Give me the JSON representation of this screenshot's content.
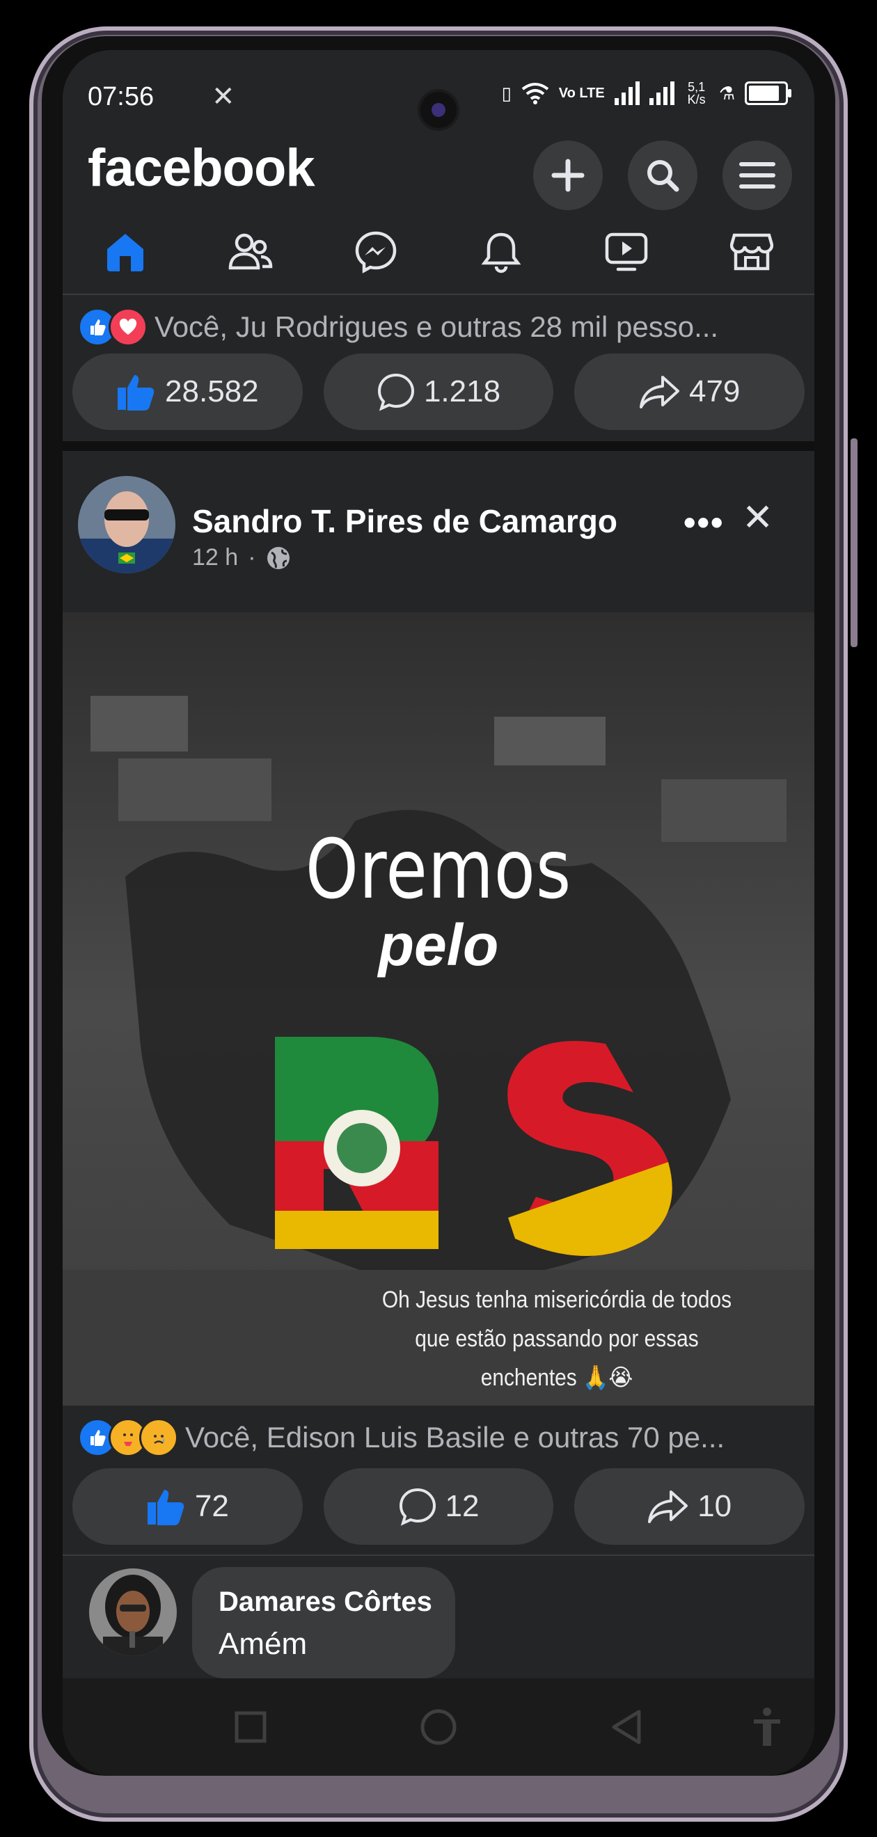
{
  "status_bar": {
    "time": "07:56",
    "app_icon": "x-icon",
    "network_speed": "5,1 K/s",
    "volte": "Vo LTE",
    "battery_level": 0.85
  },
  "header": {
    "logo": "facebook",
    "buttons": [
      "plus-icon",
      "search-icon",
      "menu-icon"
    ]
  },
  "tabs": [
    "home-icon",
    "friends-icon",
    "messenger-icon",
    "notifications-icon",
    "video-icon",
    "marketplace-icon"
  ],
  "prev_post": {
    "reactions_text": "Você, Ju Rodrigues e outras 28 mil pesso...",
    "likes": "28.582",
    "comments": "1.218",
    "shares": "479"
  },
  "post": {
    "author": "Sandro T. Pires de Camargo",
    "time": "12 h",
    "dot": "·",
    "more": "•••",
    "close": "✕",
    "image": {
      "title1": "Oremos",
      "title2": "pelo",
      "caption_lines": [
        "Oh Jesus tenha misericórdia de todos",
        "que estão passando por essas",
        "enchentes 🙏😭"
      ]
    },
    "reactions_text": "Você, Edison Luis Basile e outras 70 pe...",
    "likes": "72",
    "comments": "12",
    "shares": "10"
  },
  "comment": {
    "name": "Damares Côrtes",
    "text": "Amém"
  },
  "colors": {
    "background": "#242526",
    "button": "#3a3b3c",
    "like_blue": "#1877f2",
    "love_red": "#f33e58"
  }
}
